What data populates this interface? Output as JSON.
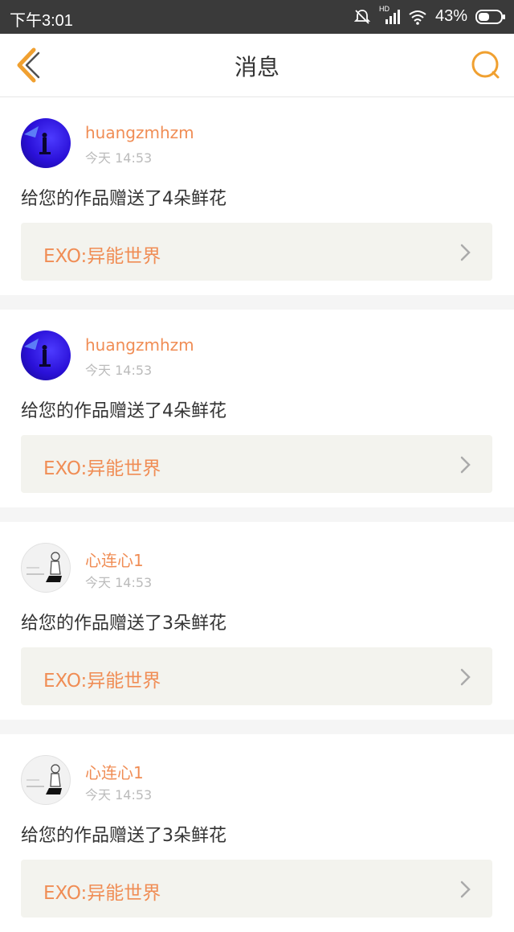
{
  "status_bar": {
    "time": "下午3:01",
    "network_label": "HD",
    "battery": "43%"
  },
  "nav": {
    "title": "消息",
    "back_icon": "chevron-left-icon",
    "search_icon": "search-icon",
    "accent_color": "#f0a030"
  },
  "messages": [
    {
      "user": "huangzmhzm",
      "time": "今天 14:53",
      "text": "给您的作品赠送了4朵鲜花",
      "work": "EXO:异能世界",
      "avatar_style": "blue"
    },
    {
      "user": "huangzmhzm",
      "time": "今天 14:53",
      "text": "给您的作品赠送了4朵鲜花",
      "work": "EXO:异能世界",
      "avatar_style": "blue"
    },
    {
      "user": "心连心1",
      "time": "今天 14:53",
      "text": "给您的作品赠送了3朵鲜花",
      "work": "EXO:异能世界",
      "avatar_style": "sketch"
    },
    {
      "user": "心连心1",
      "time": "今天 14:53",
      "text": "给您的作品赠送了3朵鲜花",
      "work": "EXO:异能世界",
      "avatar_style": "sketch"
    }
  ],
  "colors": {
    "username": "#f08d55",
    "work_title": "#f08d55",
    "link_bg": "#f3f3ee",
    "status_bar_bg": "#3a3a3a"
  }
}
